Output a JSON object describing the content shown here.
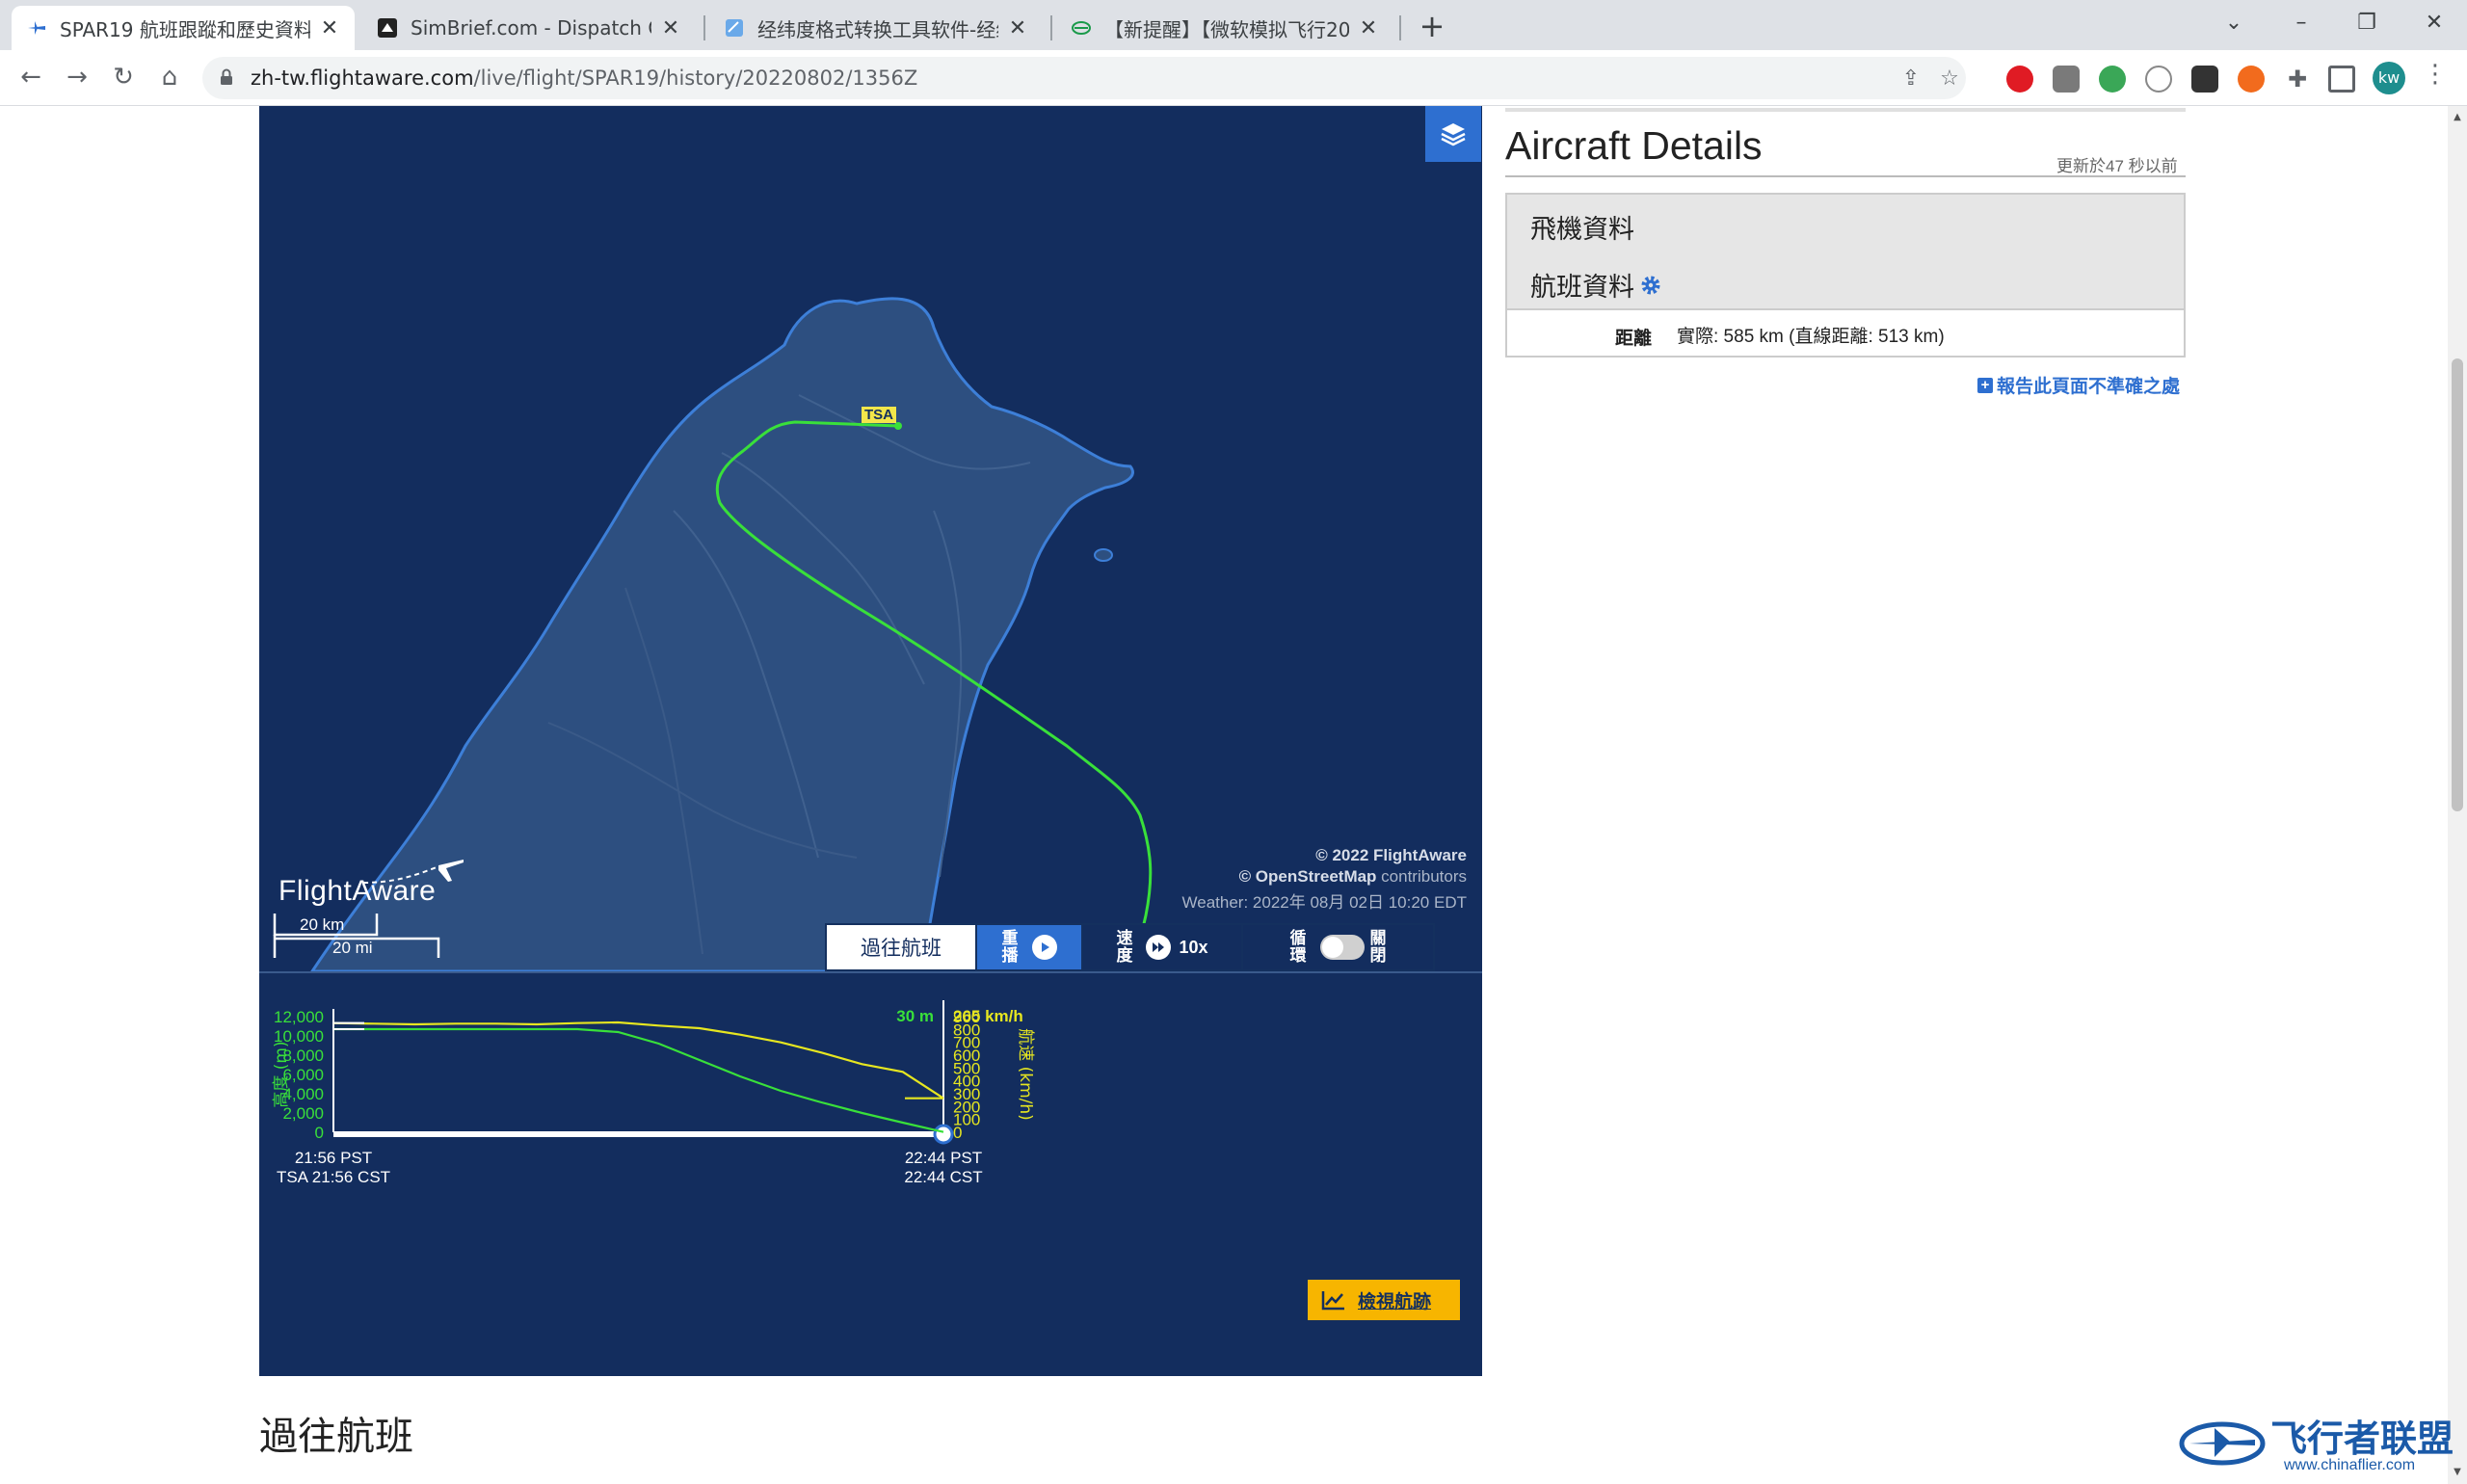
{
  "browser": {
    "tabs": [
      {
        "title": "SPAR19 航班跟蹤和歷史資料 20",
        "icon": "plane-icon"
      },
      {
        "title": "SimBrief.com - Dispatch Optic",
        "icon": "simbrief-icon"
      },
      {
        "title": "经纬度格式转换工具软件-经纬度",
        "icon": "tool-icon"
      },
      {
        "title": "【新提醒】【微软模拟飞行2020",
        "icon": "chinaflier-icon"
      }
    ],
    "url_host": "zh-tw.flightaware.com",
    "url_path": "/live/flight/SPAR19/history/20220802/1356Z",
    "profile_initials": "kw"
  },
  "map": {
    "airport_label": "TSA",
    "copyright_1": "© 2022 FlightAware",
    "copyright_2_brand": "© OpenStreetMap",
    "copyright_2_rest": " contributors",
    "weather": "Weather: 2022年 08月 02日 10:20 EDT",
    "logo_text": "FlightAware",
    "scale_km": "20 km",
    "scale_mi": "20 mi",
    "colors": {
      "sea": "#132d5e",
      "land": "#2d4f80",
      "coast": "#3d7fd8",
      "track": "#39e03a"
    }
  },
  "controls": {
    "history_label": "過往航班",
    "replay_label": [
      "重",
      "播"
    ],
    "speed_label": [
      "速",
      "度"
    ],
    "speed_value": "10x",
    "loop_label": [
      "循",
      "環"
    ],
    "loop_state": [
      "關",
      "閉"
    ]
  },
  "graph": {
    "left_axis_label": "高度 (m)",
    "right_axis_label": "航速 (km/h)",
    "left_ticks": [
      "12,000",
      "10,000",
      "8,000",
      "6,000",
      "4,000",
      "2,000",
      "0"
    ],
    "right_ticks": [
      "900",
      "800",
      "700",
      "600",
      "500",
      "400",
      "300",
      "200",
      "100",
      "0"
    ],
    "current_alt": "30 m",
    "current_speed": "265 km/h",
    "start_time_1": "21:56 PST",
    "start_time_2": "TSA 21:56 CST",
    "end_time_1": "22:44 PST",
    "end_time_2": "22:44 CST",
    "view_track_label": "檢視航跡"
  },
  "chart_data": {
    "type": "line",
    "x_label": "time",
    "x": [
      "21:56",
      "22:00",
      "22:05",
      "22:10",
      "22:15",
      "22:20",
      "22:25",
      "22:28",
      "22:30",
      "22:32",
      "22:34",
      "22:36",
      "22:38",
      "22:40",
      "22:42",
      "22:44"
    ],
    "series": [
      {
        "name": "高度 (m)",
        "axis": "left",
        "color": "#39e03a",
        "values": [
          10700,
          10700,
          10700,
          10700,
          10700,
          10700,
          10700,
          10400,
          9200,
          7500,
          5800,
          4300,
          3100,
          2000,
          1000,
          30
        ]
      },
      {
        "name": "航速 (km/h)",
        "axis": "right",
        "color": "#e6e620",
        "values": [
          850,
          845,
          840,
          845,
          845,
          840,
          850,
          855,
          830,
          810,
          760,
          700,
          620,
          530,
          470,
          265
        ]
      }
    ],
    "ylim_left": [
      0,
      12000
    ],
    "ylim_right": [
      0,
      900
    ]
  },
  "aircraft_details": {
    "title": "Aircraft Details",
    "updated": "更新於47 秒以前",
    "aircraft_info": "飛機資料",
    "flight_info": "航班資料",
    "distance_label": "距離",
    "distance_value": "實際: 585 km (直線距離: 513 km)",
    "report_link": "報告此頁面不準確之處"
  },
  "page": {
    "past_flights_heading": "過往航班"
  },
  "watermark": {
    "text": "飞行者联盟",
    "sub": "www.chinaflier.com"
  }
}
